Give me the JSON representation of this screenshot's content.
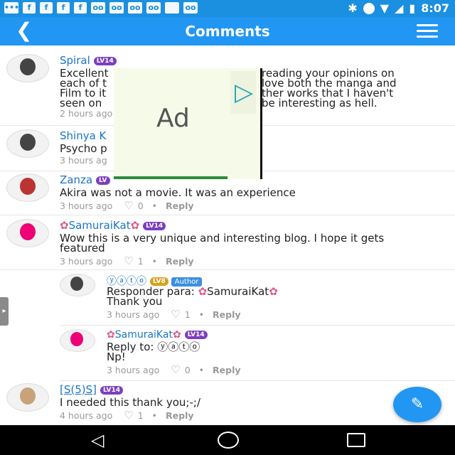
{
  "status_bar": {
    "time": "8:07",
    "left_icons": [
      "chat-icon",
      "facebook-icon",
      "facebook-icon",
      "facebook-icon",
      "facebook-icon",
      "voicemail-icon",
      "voicemail-icon",
      "voicemail-icon",
      "voicemail-icon",
      "square-icon",
      "voicemail-icon"
    ],
    "right_icons": [
      "bluetooth-icon",
      "do-not-disturb-icon",
      "wifi-icon",
      "signal-icon",
      "battery-icon"
    ]
  },
  "app_bar": {
    "back_icon": "back-arrow-icon",
    "title": "Comments",
    "filter_icon": "filter-settings-icon"
  },
  "comments": [
    {
      "username": "Spiral",
      "level": "LV14",
      "text_lines": [
        "Excellent",
        "each of t",
        "Film to it",
        "seen on"
      ],
      "text_right_lines": [
        "reading your opinions on",
        "love both the manga and",
        "ther works that I haven't",
        "be interesting as hell."
      ],
      "time": "2 hours ago"
    },
    {
      "username": "Shinya K",
      "text": "Psycho p",
      "time": "3 hours ag"
    },
    {
      "username": "Zanza",
      "level": "LV",
      "text": "Akira was not a movie. It was an experience",
      "time": "3 hours ago",
      "likes": "0",
      "reply": "Reply"
    },
    {
      "username": "SamuraiKat",
      "level": "LV14",
      "text_lines": [
        "Wow this is a very unique and interesting blog. I hope it gets",
        "featured"
      ],
      "time": "3 hours ago",
      "likes": "1",
      "reply": "Reply"
    },
    {
      "username": "ⓨⓐⓣⓞ",
      "level": "LV8",
      "badge": "Author",
      "reply_prefix": "Responder para:",
      "reply_to": "SamuraiKat",
      "text": "Thank you",
      "time": "3 hours ago",
      "likes": "1",
      "reply": "Reply"
    },
    {
      "username": "SamuraiKat",
      "level": "LV14",
      "reply_prefix": "Reply to:",
      "reply_to": "ⓨⓐⓣⓞ",
      "text": "Np!",
      "time": "3 hours ago",
      "likes": "0",
      "reply": "Reply"
    },
    {
      "username": "[S(5)S]",
      "level": "LV14",
      "text": "I needed this thank you;-;/",
      "time": "4 hours ago",
      "likes": "1",
      "reply": "Reply"
    }
  ],
  "ad": {
    "label": "Ad"
  },
  "fab": {
    "icon": "pencil-icon"
  },
  "nav": {
    "back_icon": "nav-back-icon",
    "home_icon": "nav-home-icon",
    "recents_icon": "nav-recents-icon"
  }
}
